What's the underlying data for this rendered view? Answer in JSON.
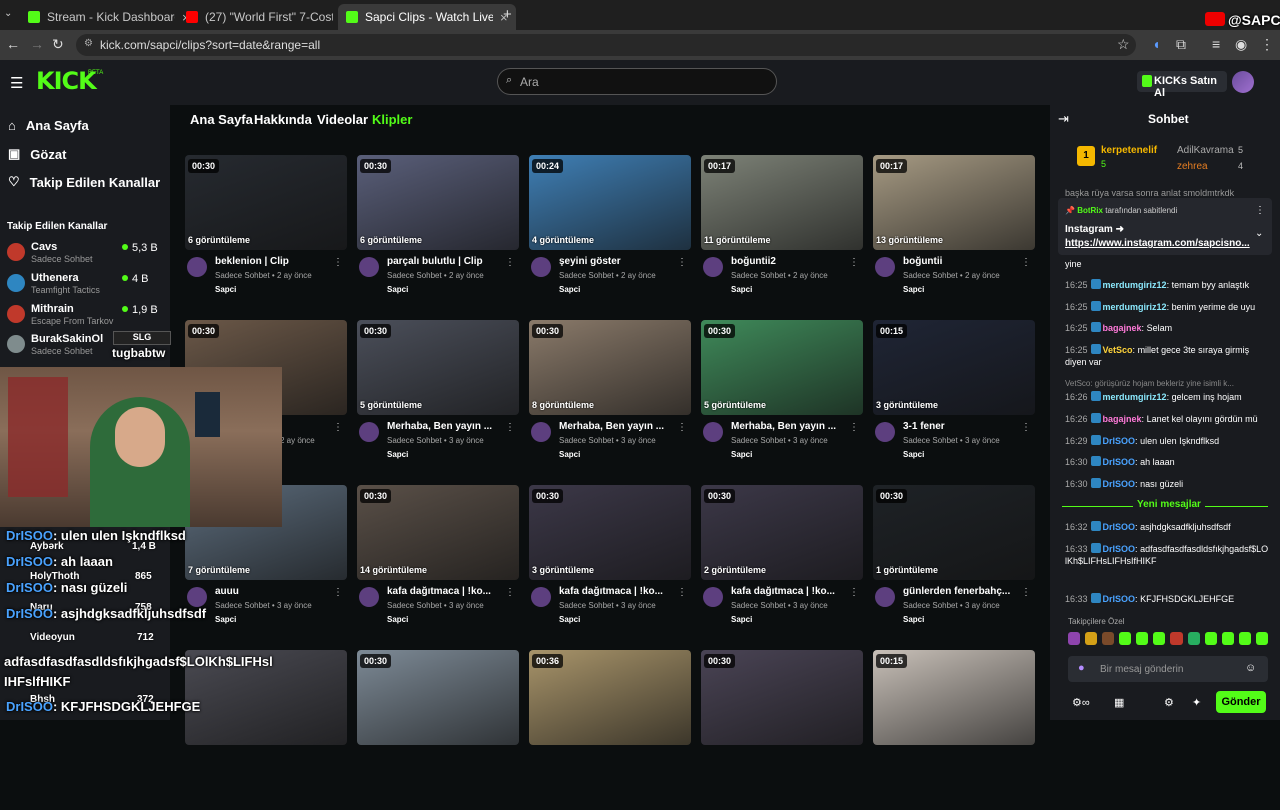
{
  "browser": {
    "tabs": [
      {
        "title": "Stream - Kick Dashboard",
        "color": "#53fc18"
      },
      {
        "title": "(27) \"World First\" 7-Cost 3-Star",
        "color": "#ff0000"
      },
      {
        "title": "Sapci Clips - Watch Live on Kick",
        "color": "#53fc18"
      }
    ],
    "url": "kick.com/sapci/clips?sort=date&range=all"
  },
  "stream_overlay": {
    "brand": "@SAPCI"
  },
  "header": {
    "logo": "KICK",
    "logo_sup": "BETA",
    "search_placeholder": "Ara",
    "kicks_button": "KICKs Satın Al"
  },
  "sidebar": {
    "nav": [
      "Ana Sayfa",
      "Gözat",
      "Takip Edilen Kanallar"
    ],
    "section_title": "Takip Edilen Kanallar",
    "channels": [
      {
        "name": "Cavs",
        "game": "Sadece Sohbet",
        "viewers": "5,3 B",
        "color": "#c0392b"
      },
      {
        "name": "Uthenera",
        "game": "Teamfight Tactics",
        "viewers": "4 B",
        "color": "#2e86c1"
      },
      {
        "name": "Mithrain",
        "game": "Escape From Tarkov",
        "viewers": "1,9 B",
        "color": "#c0392b"
      },
      {
        "name": "BurakSakinOl",
        "game": "Sadece Sohbet",
        "viewers": "",
        "color": "#7f8c8d"
      }
    ]
  },
  "main": {
    "tabs": [
      "Ana Sayfa",
      "Hakkında",
      "Videolar",
      "Klipler"
    ],
    "clips": [
      {
        "dur": "00:30",
        "views": "6 görüntüleme",
        "title": "beklenion | Clip",
        "meta": "Sadece Sohbet • 2 ay önce",
        "author": "Sapci",
        "bg": "#262a30"
      },
      {
        "dur": "00:30",
        "views": "6 görüntüleme",
        "title": "parçalı bulutlu | Clip",
        "meta": "Sadece Sohbet • 2 ay önce",
        "author": "Sapci",
        "bg": "#5a5f7a"
      },
      {
        "dur": "00:24",
        "views": "4 görüntüleme",
        "title": "şeyini göster",
        "meta": "Sadece Sohbet • 2 ay önce",
        "author": "Sapci",
        "bg": "#3f7fb5"
      },
      {
        "dur": "00:17",
        "views": "11 görüntüleme",
        "title": "boğuntii2",
        "meta": "Sadece Sohbet • 2 ay önce",
        "author": "Sapci",
        "bg": "#7d8277"
      },
      {
        "dur": "00:17",
        "views": "13 görüntüleme",
        "title": "boğuntii",
        "meta": "Sadece Sohbet • 2 ay önce",
        "author": "Sapci",
        "bg": "#a69a83"
      },
      {
        "dur": "00:30",
        "views": "",
        "title": "",
        "meta": "2 ay önce",
        "author": "",
        "bg": "#6b5848"
      },
      {
        "dur": "00:30",
        "views": "5 görüntüleme",
        "title": "Merhaba, Ben yayın ...",
        "meta": "Sadece Sohbet • 3 ay önce",
        "author": "Sapci",
        "bg": "#4b4f5a"
      },
      {
        "dur": "00:30",
        "views": "8 görüntüleme",
        "title": "Merhaba, Ben yayın ...",
        "meta": "Sadece Sohbet • 3 ay önce",
        "author": "Sapci",
        "bg": "#8a7a6a"
      },
      {
        "dur": "00:30",
        "views": "5 görüntüleme",
        "title": "Merhaba, Ben yayın ...",
        "meta": "Sadece Sohbet • 3 ay önce",
        "author": "Sapci",
        "bg": "#3f8a5a"
      },
      {
        "dur": "00:15",
        "views": "3 görüntüleme",
        "title": "3-1 fener",
        "meta": "Sadece Sohbet • 3 ay önce",
        "author": "Sapci",
        "bg": "#1f2535"
      },
      {
        "dur": "",
        "views": "7 görüntüleme",
        "title": "auuu",
        "meta": "Sadece Sohbet • 3 ay önce",
        "author": "Sapci",
        "bg": "#5c6c7c"
      },
      {
        "dur": "00:30",
        "views": "14 görüntüleme",
        "title": "kafa dağıtmaca | !ko...",
        "meta": "Sadece Sohbet • 3 ay önce",
        "author": "Sapci",
        "bg": "#5a5048"
      },
      {
        "dur": "00:30",
        "views": "3 görüntüleme",
        "title": "kafa dağıtmaca | !ko...",
        "meta": "Sadece Sohbet • 3 ay önce",
        "author": "Sapci",
        "bg": "#3c3848"
      },
      {
        "dur": "00:30",
        "views": "2 görüntüleme",
        "title": "kafa dağıtmaca | !ko...",
        "meta": "Sadece Sohbet • 3 ay önce",
        "author": "Sapci",
        "bg": "#3c3848"
      },
      {
        "dur": "00:30",
        "views": "1 görüntüleme",
        "title": "günlerden fenerbahç...",
        "meta": "Sadece Sohbet • 3 ay önce",
        "author": "Sapci",
        "bg": "#1e2226"
      },
      {
        "dur": "",
        "views": "",
        "title": "",
        "meta": "",
        "author": "",
        "bg": "#4a4a52"
      },
      {
        "dur": "00:30",
        "views": "",
        "title": "",
        "meta": "",
        "author": "",
        "bg": "#7d8a96"
      },
      {
        "dur": "00:36",
        "views": "",
        "title": "",
        "meta": "",
        "author": "",
        "bg": "#a8946a"
      },
      {
        "dur": "00:30",
        "views": "",
        "title": "",
        "meta": "",
        "author": "",
        "bg": "#4a4455"
      },
      {
        "dur": "00:15",
        "views": "",
        "title": "",
        "meta": "",
        "author": "",
        "bg": "#c8c0b8"
      }
    ]
  },
  "chat": {
    "title": "Sohbet",
    "leaders": [
      {
        "name": "kerpetenelif",
        "count": "5"
      },
      {
        "name": "AdilKavrama",
        "count": "5"
      },
      {
        "name": "zehrea",
        "count": "4"
      }
    ],
    "pinned_partial": "başka rüya varsa sonra anlat smoldmtrkdk",
    "pinned_by": "BotRix",
    "pinned_by_suffix": "tarafından sabitlendi",
    "pinned_title": "Instagram ➜",
    "pinned_link": "https://www.instagram.com/sapcisno...",
    "pre_line": "yine",
    "messages": [
      {
        "time": "16:25",
        "user": "merdumgiriz12",
        "text": "temam byy anlaştık",
        "ucolor": "#8be9fd"
      },
      {
        "time": "16:25",
        "user": "merdumgiriz12",
        "text": "benim yerime de uyu",
        "ucolor": "#8be9fd"
      },
      {
        "time": "16:25",
        "user": "bagajnek",
        "text": "Selam",
        "ucolor": "#ff7ad9"
      },
      {
        "time": "16:25",
        "user": "VetSco",
        "text": "millet gece 3te sıraya girmiş diyen var",
        "ucolor": "#ffd43b"
      }
    ],
    "reply_hint": "VetSco: görüşürüz hojam bekleriz yine isimli k...",
    "messages2": [
      {
        "time": "16:26",
        "user": "merdumgiriz12",
        "text": "gelcem inş hojam",
        "ucolor": "#8be9fd"
      },
      {
        "time": "16:26",
        "user": "bagajnek",
        "text": "Lanet kel olayını gördün mü",
        "ucolor": "#ff7ad9"
      },
      {
        "time": "16:29",
        "user": "DrISOO",
        "text": "ulen ulen Işkndflksd",
        "ucolor": "#4aa3ff"
      },
      {
        "time": "16:30",
        "user": "DrISOO",
        "text": "ah laaan",
        "ucolor": "#4aa3ff"
      },
      {
        "time": "16:30",
        "user": "DrISOO",
        "text": "nası güzeli",
        "ucolor": "#4aa3ff"
      }
    ],
    "new_messages": "Yeni mesajlar",
    "messages3": [
      {
        "time": "16:32",
        "user": "DrISOO",
        "text": "asjhdgksadfkljuhsdfsdf",
        "ucolor": "#4aa3ff"
      },
      {
        "time": "16:33",
        "user": "DrISOO",
        "text": "adfasdfasdfasdldsfıkjhgadsf$LOlKh$LIFHsLIFHsIfHIKF",
        "ucolor": "#4aa3ff"
      },
      {
        "time": "16:33",
        "user": "DrISOO",
        "text": "KFJFHSDGKLJEHFGE",
        "ucolor": "#4aa3ff"
      }
    ],
    "follower_label": "Takipçilere Özel",
    "input_placeholder": "Bir mesaj gönderin",
    "send_button": "Gönder"
  },
  "overlay": {
    "tag1": "tugbabtw",
    "chat_lines": [
      {
        "user": "DrISOO",
        "text": ": ulen ulen Işkndflksd"
      },
      {
        "user": "DrISOO",
        "text": ": ah laaan"
      },
      {
        "user": "DrISOO",
        "text": ": nası güzeli"
      },
      {
        "user": "DrISOO",
        "text": ": asjhdgksadfkljuhsdfsdf"
      },
      {
        "user": "",
        "text": "adfasdfasdfasdldsfıkjhgadsf$LOlKh$LIFHsl"
      },
      {
        "user": "",
        "text": "IHFslfHIKF"
      },
      {
        "user": "DrISOO",
        "text": ": KFJFHSDGKLJEHFGE"
      }
    ],
    "side_channels": [
      {
        "name": "Aybərk",
        "viewers": "1,4 B"
      },
      {
        "name": "HolyThoth",
        "viewers": "865"
      },
      {
        "name": "Naru",
        "viewers": "758"
      },
      {
        "name": "Videoyun",
        "viewers": "712"
      },
      {
        "name": "Bhsh",
        "viewers": "372"
      }
    ]
  }
}
